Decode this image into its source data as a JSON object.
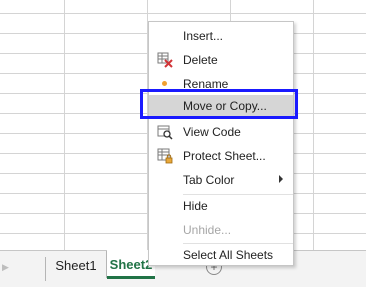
{
  "sheet_tabs": [
    {
      "label": "Sheet1"
    },
    {
      "label": "Sheet2",
      "visible_text": "Sheet2"
    }
  ],
  "context_menu": {
    "items": [
      {
        "label": "Insert...",
        "mnemonic": "I",
        "enabled": true,
        "icon": ""
      },
      {
        "label": "Delete",
        "mnemonic": "D",
        "enabled": true,
        "icon": "delete-sheet-icon"
      },
      {
        "label": "Rename",
        "mnemonic": "R",
        "enabled": true,
        "icon": "rename-dot-icon"
      },
      {
        "label": "Move or Copy...",
        "mnemonic": "M",
        "enabled": true,
        "highlighted": true,
        "icon": ""
      },
      {
        "label": "View Code",
        "mnemonic": "V",
        "enabled": true,
        "icon": "view-code-icon"
      },
      {
        "label": "Protect Sheet...",
        "mnemonic": "P",
        "enabled": true,
        "icon": "protect-sheet-icon"
      },
      {
        "label": "Tab Color",
        "mnemonic": "T",
        "enabled": true,
        "submenu": true,
        "icon": ""
      },
      {
        "label": "Hide",
        "mnemonic": "H",
        "enabled": true,
        "icon": ""
      },
      {
        "label": "Unhide...",
        "mnemonic": "U",
        "enabled": false,
        "icon": ""
      },
      {
        "label": "Select All Sheets",
        "mnemonic": "S",
        "enabled": true,
        "icon": ""
      }
    ]
  },
  "colors": {
    "accent_tab": "#217346",
    "highlight_frame": "#1a1aff",
    "menu_hover": "#d6d6d6"
  }
}
